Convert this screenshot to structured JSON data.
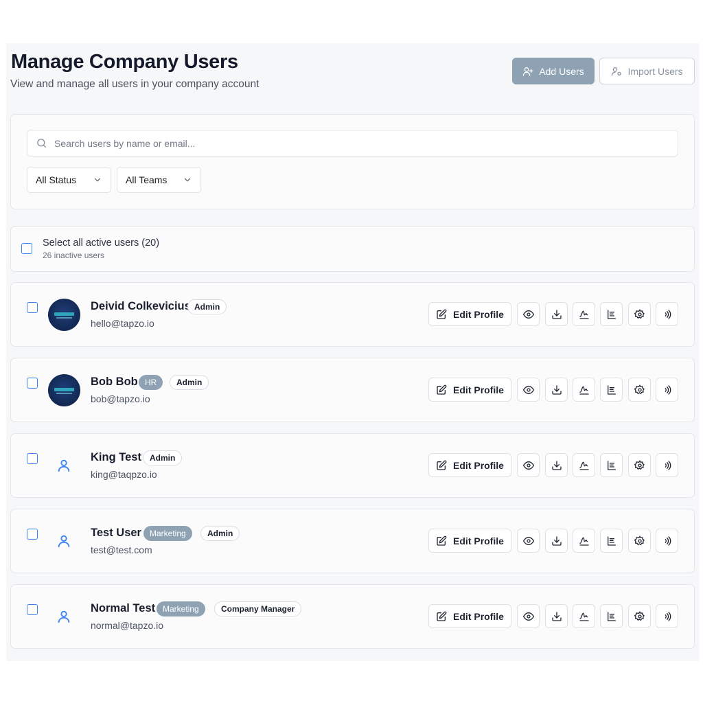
{
  "header": {
    "title": "Manage Company Users",
    "subtitle": "View and manage all users in your company account",
    "add_users_label": "Add Users",
    "import_users_label": "Import Users"
  },
  "filters": {
    "search_placeholder": "Search users by name or email...",
    "status_select": "All Status",
    "teams_select": "All Teams"
  },
  "selection": {
    "select_all_label": "Select all active users (20)",
    "inactive_note": "26 inactive users"
  },
  "actions": {
    "edit_profile_label": "Edit Profile",
    "icons": [
      "view-icon",
      "download-icon",
      "signature-icon",
      "list-icon",
      "settings-icon",
      "nfc-icon"
    ]
  },
  "users": [
    {
      "name": "Deivid Colkevicius",
      "email": "hello@tapzo.io",
      "team": "",
      "role": "Admin",
      "avatar": "logo"
    },
    {
      "name": "Bob Bob",
      "email": "bob@tapzo.io",
      "team": "HR",
      "role": "Admin",
      "avatar": "logo"
    },
    {
      "name": "King Test",
      "email": "king@taqpzo.io",
      "team": "",
      "role": "Admin",
      "avatar": "default"
    },
    {
      "name": "Test User",
      "email": "test@test.com",
      "team": "Marketing",
      "role": "Admin",
      "avatar": "default"
    },
    {
      "name": "Normal Test",
      "email": "normal@tapzo.io",
      "team": "Marketing",
      "role": "Company Manager",
      "avatar": "default"
    }
  ],
  "colors": {
    "accent_checkbox": "#3b82f6",
    "team_badge": "#8ea2b3",
    "primary_button": "#8ea2b3"
  }
}
